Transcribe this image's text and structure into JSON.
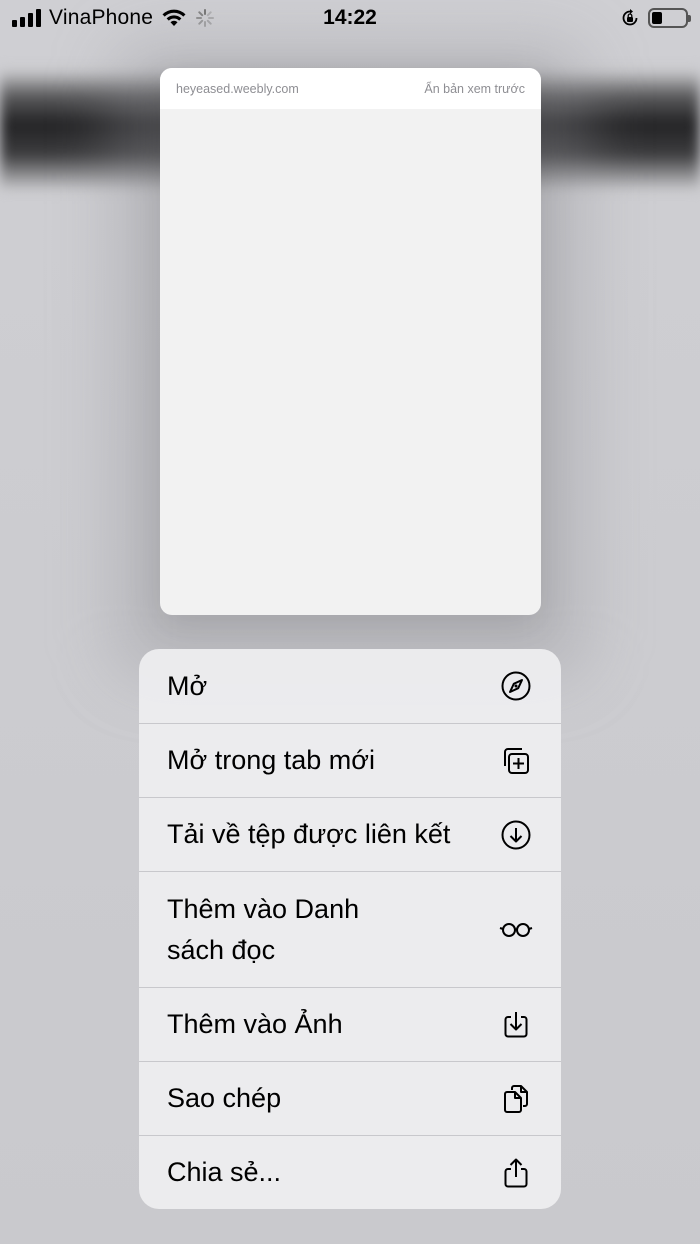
{
  "status_bar": {
    "carrier": "VinaPhone",
    "time": "14:22",
    "battery_level": 0.3
  },
  "preview": {
    "domain": "heyeased.weebly.com",
    "hide_preview_label": "Ẩn bản xem trước"
  },
  "menu": {
    "items": [
      {
        "label": "Mở",
        "icon": "compass-icon"
      },
      {
        "label": "Mở trong tab mới",
        "icon": "new-tab-icon"
      },
      {
        "label": "Tải về tệp được liên kết",
        "icon": "download-icon"
      },
      {
        "label": "Thêm vào Danh sách đọc",
        "icon": "glasses-icon"
      },
      {
        "label": "Thêm vào Ảnh",
        "icon": "save-to-photos-icon"
      },
      {
        "label": "Sao chép",
        "icon": "copy-icon"
      },
      {
        "label": "Chia sẻ...",
        "icon": "share-icon"
      }
    ]
  }
}
